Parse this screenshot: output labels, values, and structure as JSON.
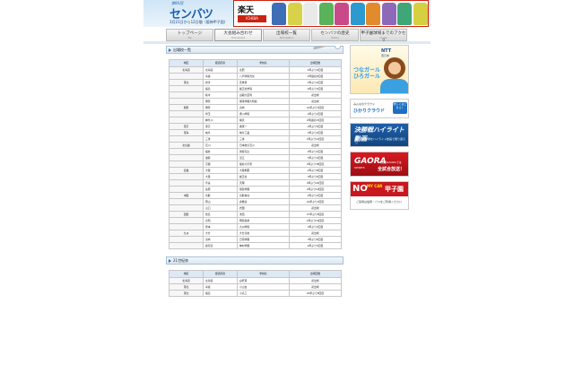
{
  "header": {
    "logo_sub": "第86回",
    "logo_main": "センバツ",
    "logo_date": "3月21日から12日間（阪神甲子園）",
    "ad_brand": "楽天",
    "ad_brand_sub": "ICHIBA",
    "shirt_colors": [
      "#3e6fb6",
      "#d8d24a",
      "#e9e9e9",
      "#58b35a",
      "#c94a8a",
      "#2c9ad1",
      "#e28b2d",
      "#8d6ab8",
      "#3fa678",
      "#d6d040"
    ]
  },
  "nav": [
    {
      "label": "トップページ",
      "en": "Top"
    },
    {
      "label": "大会組み合わせ",
      "en": "Tournament"
    },
    {
      "label": "出場校一覧",
      "en": "Participation"
    },
    {
      "label": "センバツの歴史",
      "en": "History"
    },
    {
      "label": "甲子園球場までのアクセス",
      "en": "Access"
    }
  ],
  "section1": {
    "title": "出場校一覧",
    "columns": [
      "地区",
      "都道府県",
      "学校名",
      "出場回数"
    ],
    "rows": [
      [
        "北海道",
        "北海道",
        "北照",
        "4年ぶり4回目"
      ],
      [
        "",
        "青森",
        "八戸学院光星",
        "2年連続9回目"
      ],
      [
        "東北",
        "岩手",
        "花巻東",
        "3年ぶり2回目"
      ],
      [
        "",
        "福島",
        "履正社学院",
        "4年ぶり3回目"
      ],
      [
        "",
        "栃木",
        "白鷗大足利",
        "初出場"
      ],
      [
        "",
        "群馬",
        "関東学園大附属",
        "初出場"
      ],
      [
        "関東",
        "群馬",
        "高崎",
        "41年ぶり3回目"
      ],
      [
        "",
        "埼玉",
        "豊川学院",
        "4年ぶり2回目"
      ],
      [
        "",
        "神奈川",
        "横浜",
        "2年連続15回目"
      ],
      [
        "東京",
        "東京",
        "関東一",
        "2年ぶり5回目"
      ],
      [
        "東海",
        "岐阜",
        "岐阜工業",
        "3年ぶり2回目"
      ],
      [
        "",
        "三重",
        "三重",
        "2年ぶり12回目"
      ],
      [
        "北信越",
        "石川",
        "日本航空石川",
        "初出場"
      ],
      [
        "",
        "福井",
        "敦賀気比",
        "2年ぶり2回目"
      ],
      [
        "",
        "滋賀",
        "近江",
        "3年ぶり4回目"
      ],
      [
        "",
        "京都",
        "龍谷大平安",
        "4年ぶり38回目"
      ],
      [
        "近畿",
        "大阪",
        "大阪桐蔭",
        "2年ぶり8回目"
      ],
      [
        "",
        "大阪",
        "履正社",
        "3年ぶり5回目"
      ],
      [
        "",
        "奈良",
        "天理",
        "4年ぶり22回目"
      ],
      [
        "",
        "兵庫",
        "報徳学園",
        "2年ぶり19回目"
      ],
      [
        "中国",
        "鳥取",
        "鳥取城北",
        "2年ぶり2回目"
      ],
      [
        "",
        "岡山",
        "倉敷商",
        "22年ぶり3回目"
      ],
      [
        "",
        "山口",
        "岩国",
        "初出場"
      ],
      [
        "四国",
        "徳島",
        "池田",
        "27年ぶり8回目"
      ],
      [
        "",
        "高知",
        "明徳義塾",
        "2年ぶり16回目"
      ],
      [
        "",
        "熊本",
        "九州学院",
        "3年ぶり3回目"
      ],
      [
        "九州",
        "大分",
        "大分高校",
        "初出場"
      ],
      [
        "",
        "宮崎",
        "日南学園",
        "3年ぶり6回目"
      ],
      [
        "",
        "鹿児島",
        "神村学園",
        "2年ぶり3回目"
      ]
    ]
  },
  "section2": {
    "title": "21世紀枠",
    "columns": [
      "地区",
      "都道府県",
      "学校名",
      "出場回数"
    ],
    "rows": [
      [
        "北海道",
        "北海道",
        "白老東",
        "初出場"
      ],
      [
        "東北",
        "青森",
        "小山台",
        "初出場"
      ],
      [
        "東北",
        "福島",
        "小高工",
        "24年ぶり8回目"
      ]
    ]
  },
  "sidebar": {
    "banner1": {
      "ntt": "NTT",
      "ntt_sub": "西日本",
      "text": "つなガールひろガール"
    },
    "banner2": {
      "line1": "みんなのクラウド",
      "line2": "ひかりクラウド",
      "btn": "詳しくはこちら！"
    },
    "banner3": {
      "title": "決勝戦ハイライト動画",
      "sub": "過去の決勝戦をハイライト動画で振り返ろう！"
    },
    "banner4": {
      "title": "GAORA",
      "title_sub": "SPORTS",
      "sub": "CS放送GAORAでは",
      "sub2": "全試合放送！"
    },
    "banner5": {
      "no": "NO",
      "mycar": "MY CAR",
      "koshien": "甲子園",
      "sub": "ご来場は電車・バスをご利用ください"
    }
  }
}
